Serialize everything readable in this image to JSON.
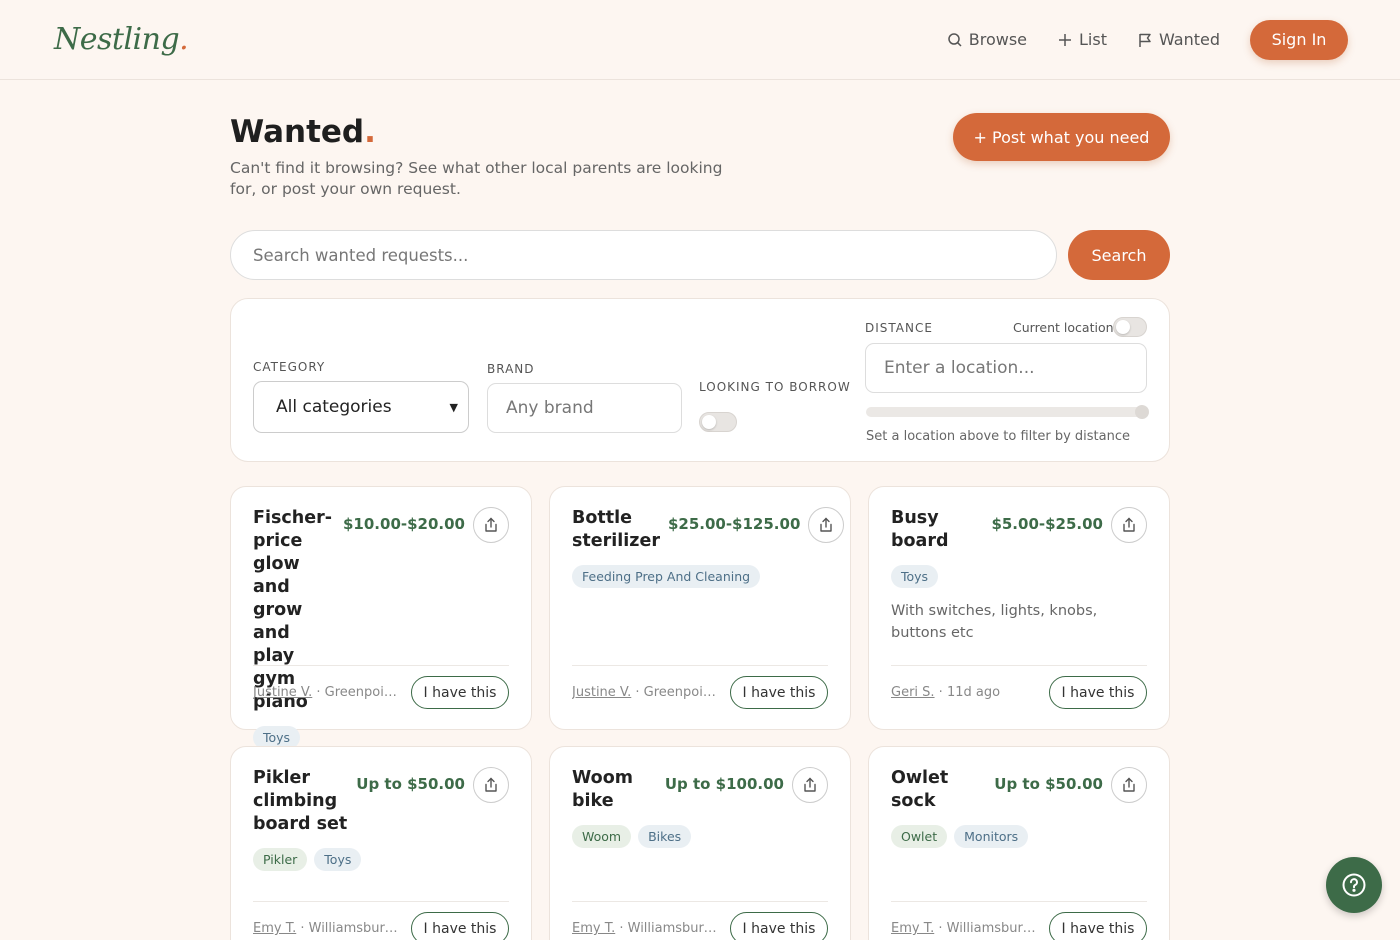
{
  "brand": {
    "logo_text": "Nestling",
    "logo_dot": "."
  },
  "nav": {
    "browse": "Browse",
    "list": "List",
    "wanted": "Wanted",
    "sign_in": "Sign In"
  },
  "page": {
    "title": "Wanted",
    "title_dot": ".",
    "subtitle": "Can't find it browsing? See what other local parents are looking for, or post your own request.",
    "post_button": "+ Post what you need"
  },
  "search": {
    "placeholder": "Search wanted requests...",
    "button": "Search"
  },
  "filters": {
    "category_label": "CATEGORY",
    "category_value": "All categories",
    "brand_label": "BRAND",
    "brand_placeholder": "Any brand",
    "borrow_label": "LOOKING TO BORROW",
    "borrow_on": false,
    "distance_label": "DISTANCE",
    "current_location_label": "Current location",
    "current_location_on": false,
    "location_placeholder": "Enter a location...",
    "distance_hint": "Set a location above to filter by distance"
  },
  "cards": [
    {
      "title": "Fischer-price glow and grow and play gym piano",
      "price": "$10.00-$20.00",
      "tags": [
        "Toys"
      ],
      "brand_tags": [],
      "description": "",
      "user": "Justine V.",
      "meta": " · Greenpoint...",
      "action": "I have this"
    },
    {
      "title": "Bottle sterilizer",
      "price": "$25.00-$125.00",
      "tags": [
        "Feeding Prep And Cleaning"
      ],
      "brand_tags": [],
      "description": "",
      "user": "Justine V.",
      "meta": " · Greenpoint...",
      "action": "I have this"
    },
    {
      "title": "Busy board",
      "price": "$5.00-$25.00",
      "tags": [
        "Toys"
      ],
      "brand_tags": [],
      "description": "With switches, lights, knobs, buttons etc",
      "user": "Geri S.",
      "meta": " · 11d ago",
      "action": "I have this"
    },
    {
      "title": "Pikler climbing board set",
      "price": "Up to $50.00",
      "tags": [
        "Toys"
      ],
      "brand_tags": [
        "Pikler"
      ],
      "description": "",
      "user": "Emy T.",
      "meta": " · Williamsburg · ...",
      "action": "I have this"
    },
    {
      "title": "Woom bike",
      "price": "Up to $100.00",
      "tags": [
        "Bikes"
      ],
      "brand_tags": [
        "Woom"
      ],
      "description": "",
      "user": "Emy T.",
      "meta": " · Williamsburg · ...",
      "action": "I have this"
    },
    {
      "title": "Owlet sock",
      "price": "Up to $50.00",
      "tags": [
        "Monitors"
      ],
      "brand_tags": [
        "Owlet"
      ],
      "description": "",
      "user": "Emy T.",
      "meta": " · Williamsburg · ...",
      "action": "I have this"
    }
  ],
  "colors": {
    "accent": "#d4693a",
    "brand_green": "#3d6b48",
    "background": "#fdf6f1"
  },
  "icons": {
    "browse": "search-icon",
    "list": "plus-icon",
    "wanted": "flag-icon",
    "share": "share-icon",
    "help": "help-icon"
  }
}
